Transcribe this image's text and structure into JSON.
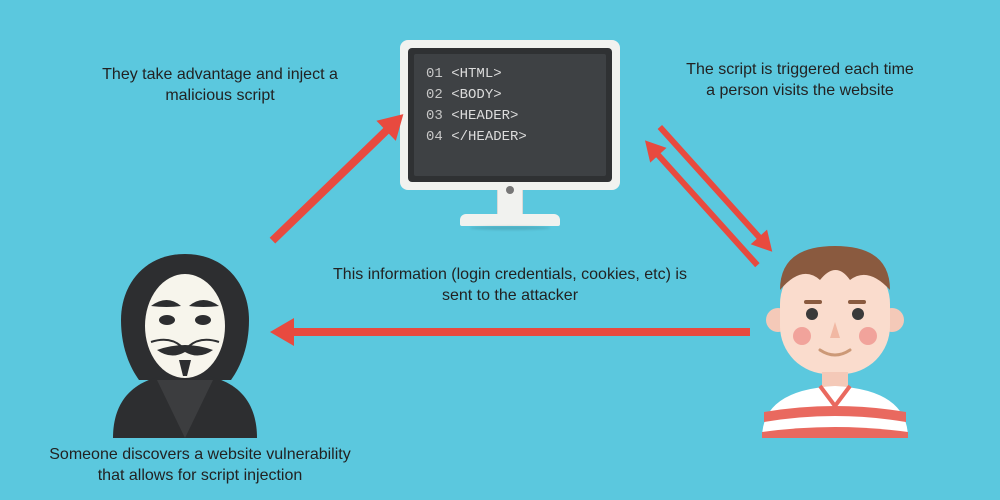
{
  "labels": {
    "inject": "They take advantage and inject a malicious script",
    "trigger": "The script is triggered each time a person visits the website",
    "send": "This information (login credentials, cookies, etc) is sent to the attacker",
    "discover": "Someone discovers a website vulnerability that allows for script injection"
  },
  "code": {
    "l1_num": "01 ",
    "l1_txt": "<HTML>",
    "l2_num": "02 ",
    "l2_txt": "<BODY>",
    "l3_num": "03 ",
    "l3_txt": "<HEADER>",
    "l4_num": "04 ",
    "l4_txt": "</HEADER>"
  }
}
